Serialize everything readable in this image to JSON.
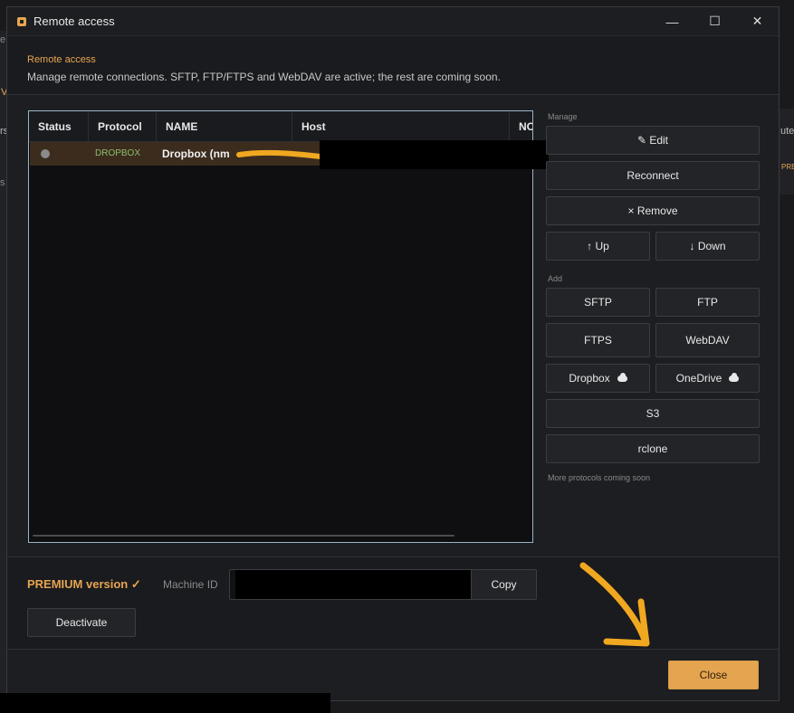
{
  "window": {
    "title": "Remote access",
    "controls": {
      "minimize": "—",
      "maximize": "☐",
      "close": "✕"
    }
  },
  "header": {
    "title": "Remote access",
    "subtitle": "Manage remote connections. SFTP, FTP/FTPS and WebDAV are active; the rest are coming soon."
  },
  "table": {
    "columns": [
      "Status",
      "Protocol",
      "NAME",
      "Host",
      "NO"
    ],
    "rows": [
      {
        "protocol": "DROPBOX",
        "name": "Dropbox (nm"
      }
    ]
  },
  "manage": {
    "label": "Manage",
    "edit": "✎ Edit",
    "reconnect": "Reconnect",
    "remove": "× Remove",
    "up": "↑ Up",
    "down": "↓ Down"
  },
  "add": {
    "label": "Add",
    "sftp": "SFTP",
    "ftp": "FTP",
    "ftps": "FTPS",
    "webdav": "WebDAV",
    "dropbox": "Dropbox",
    "onedrive": "OneDrive",
    "s3": "S3",
    "rclone": "rclone",
    "note": "More protocols coming soon"
  },
  "license": {
    "status": "PREMIUM version ✓",
    "machine_id_label": "Machine ID",
    "copy": "Copy",
    "deactivate": "Deactivate"
  },
  "footer": {
    "close": "Close"
  },
  "background": {
    "left_fragments": [
      "e",
      "V",
      "rs",
      "s"
    ],
    "right_fragments": [
      "ute",
      "PRE"
    ]
  },
  "colors": {
    "accent": "#e5a550",
    "protocol_green": "#8fbf6a",
    "selected_row": "#3b2c1e",
    "table_border": "#9bb4c8"
  }
}
